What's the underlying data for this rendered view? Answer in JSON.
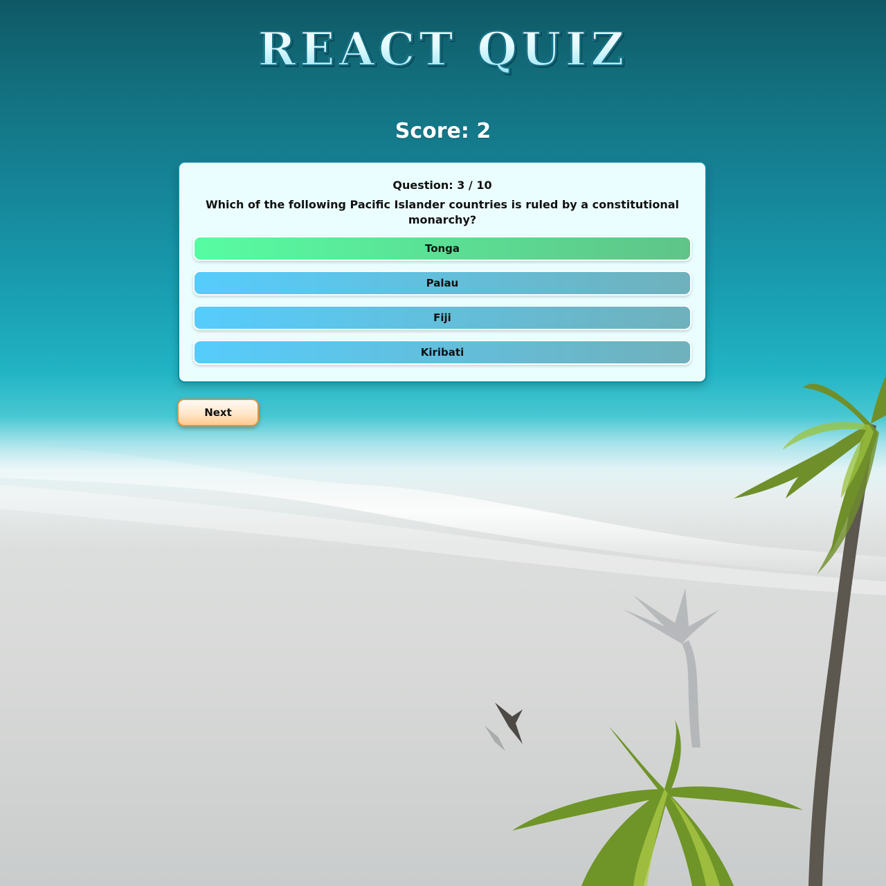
{
  "header": {
    "title": "REACT QUIZ"
  },
  "score": {
    "label": "Score: 2"
  },
  "question": {
    "number_label": "Question: 3 / 10",
    "text": "Which of the following Pacific Islander countries is ruled by a constitutional monarchy?"
  },
  "answers": [
    {
      "label": "Tonga",
      "state": "correct"
    },
    {
      "label": "Palau",
      "state": "default"
    },
    {
      "label": "Fiji",
      "state": "default"
    },
    {
      "label": "Kiribati",
      "state": "default"
    }
  ],
  "controls": {
    "next_label": "Next"
  },
  "colors": {
    "correct_answer": "#57fca2",
    "answer": "#56ccfc",
    "next_button": "#ffe7c9",
    "card_background": "#ebfeff"
  }
}
